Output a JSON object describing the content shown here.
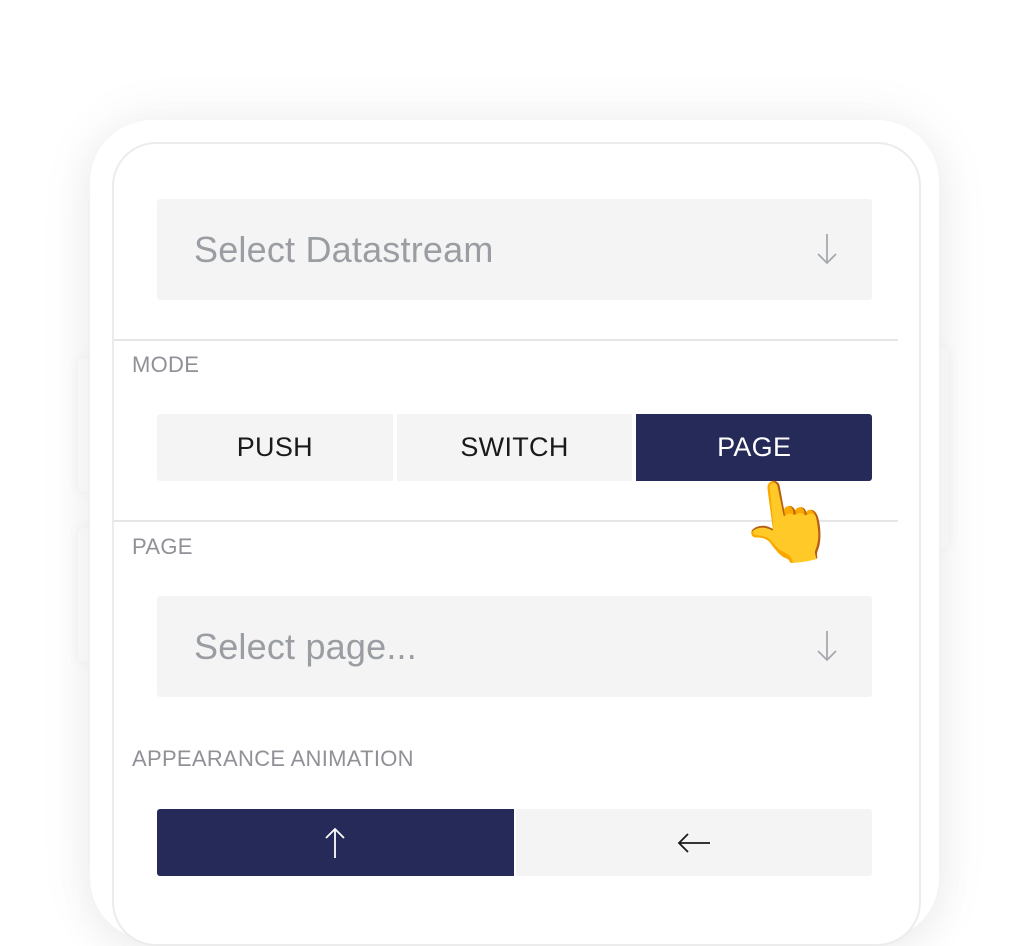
{
  "datastream": {
    "placeholder": "Select Datastream",
    "icon": "arrow-down-icon"
  },
  "mode": {
    "label": "MODE",
    "options": [
      "PUSH",
      "SWITCH",
      "PAGE"
    ],
    "selected": "PAGE"
  },
  "page": {
    "label": "PAGE",
    "placeholder": "Select page...",
    "icon": "arrow-down-icon"
  },
  "animation": {
    "label": "APPEARANCE ANIMATION",
    "options": [
      "arrow-up-icon",
      "arrow-left-icon"
    ],
    "selected": "arrow-up-icon"
  },
  "cursor": {
    "glyph": "👆",
    "icon": "pointing-hand-icon"
  },
  "colors": {
    "accent": "#262a59",
    "field_bg": "#f4f4f5",
    "label": "#8f9196",
    "placeholder": "#9a9da2"
  }
}
